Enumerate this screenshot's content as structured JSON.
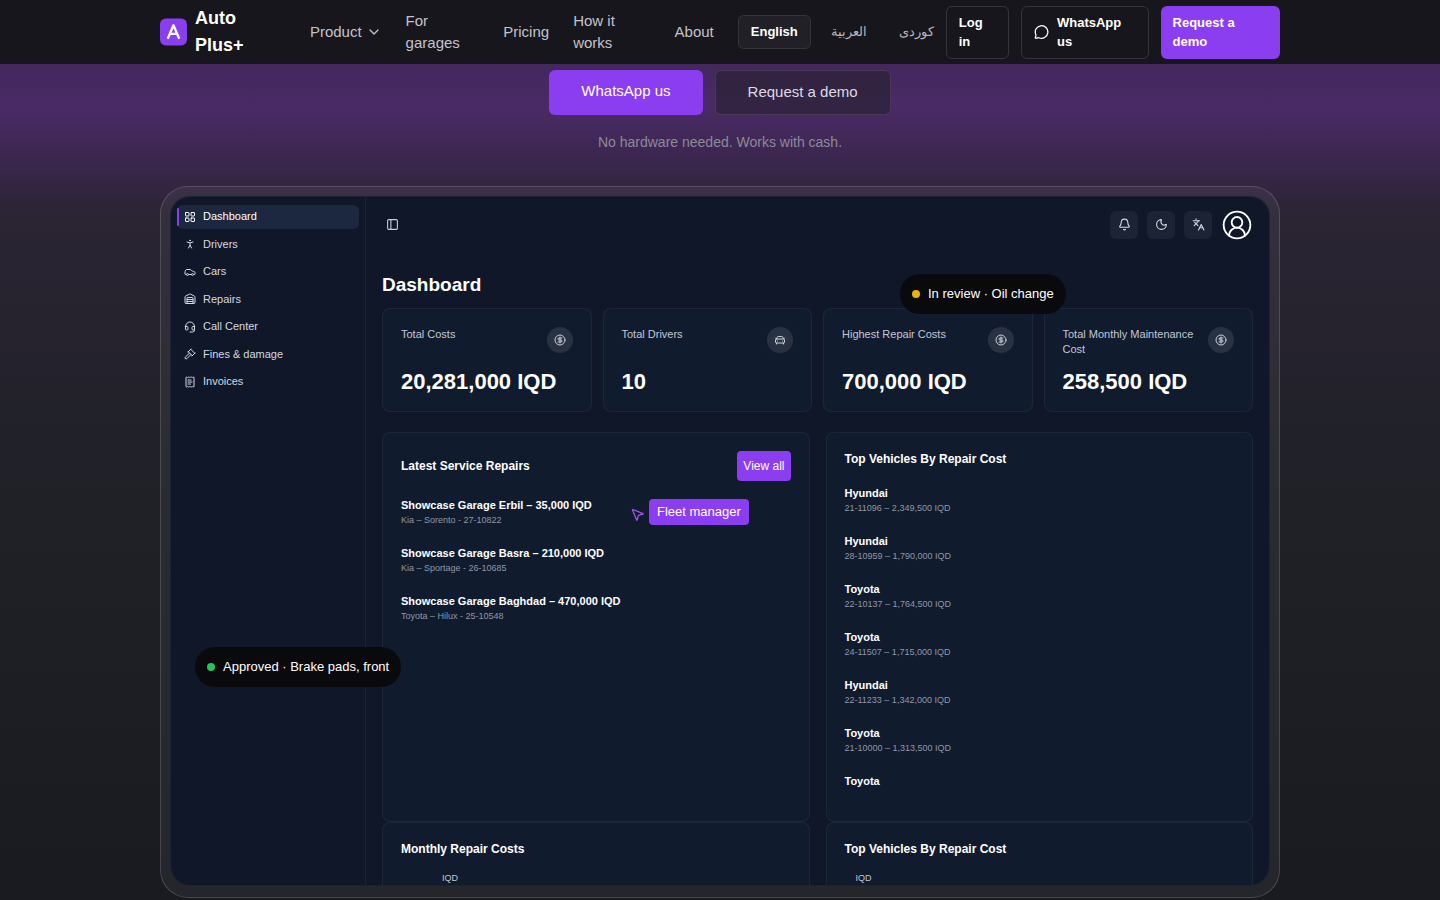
{
  "nav": {
    "brand": "Auto Plus+",
    "links": [
      {
        "label": "Product",
        "dropdown": true
      },
      {
        "label": "For garages",
        "dropdown": false
      },
      {
        "label": "Pricing",
        "dropdown": false
      },
      {
        "label": "How it works",
        "dropdown": false
      },
      {
        "label": "About",
        "dropdown": false
      }
    ],
    "languages": [
      {
        "label": "English",
        "selected": true
      },
      {
        "label": "العربية",
        "selected": false
      },
      {
        "label": "كوردی",
        "selected": false
      }
    ],
    "login": "Log in",
    "whatsapp": "WhatsApp us",
    "demo": "Request a demo"
  },
  "hero": {
    "buttons": [
      {
        "label": "WhatsApp us",
        "primary": true
      },
      {
        "label": "Request a demo",
        "primary": false
      }
    ],
    "note": "No hardware needed. Works with cash."
  },
  "dashboard": {
    "sidebar": [
      {
        "label": "Dashboard",
        "selected": true
      },
      {
        "label": "Drivers",
        "selected": false
      },
      {
        "label": "Cars",
        "selected": false
      },
      {
        "label": "Repairs",
        "selected": false
      },
      {
        "label": "Call Center",
        "selected": false
      },
      {
        "label": "Fines & damage",
        "selected": false
      },
      {
        "label": "Invoices",
        "selected": false
      }
    ],
    "title": "Dashboard",
    "stats": [
      {
        "label": "Total Costs",
        "value": "20,281,000 IQD"
      },
      {
        "label": "Total Drivers",
        "value": "10"
      },
      {
        "label": "Highest Repair Costs",
        "value": "700,000 IQD"
      },
      {
        "label": "Total Monthly Maintenance Cost",
        "value": "258,500 IQD"
      }
    ],
    "latest": {
      "title": "Latest Service Repairs",
      "action": "View all",
      "items": [
        {
          "title": "Showcase Garage Erbil – 35,000 IQD",
          "sub": "Kia – Sorento - 27-10822"
        },
        {
          "title": "Showcase Garage Basra – 210,000 IQD",
          "sub": "Kia – Sportage - 26-10685"
        },
        {
          "title": "Showcase Garage Baghdad – 470,000 IQD",
          "sub": "Toyota – Hilux - 25-10548"
        }
      ]
    },
    "top": {
      "title": "Top Vehicles By Repair Cost",
      "items": [
        {
          "name": "Hyundai",
          "sub": "21-11096 – 2,349,500 IQD"
        },
        {
          "name": "Hyundai",
          "sub": "28-10959 – 1,790,000 IQD"
        },
        {
          "name": "Toyota",
          "sub": "22-10137 – 1,764,500 IQD"
        },
        {
          "name": "Toyota",
          "sub": "24-11507 – 1,715,000 IQD"
        },
        {
          "name": "Hyundai",
          "sub": "22-11233 – 1,342,000 IQD"
        },
        {
          "name": "Toyota",
          "sub": "21-10000 – 1,313,500 IQD"
        },
        {
          "name": "Toyota",
          "sub": ""
        }
      ]
    },
    "bottom": [
      {
        "title": "Monthly Repair Costs",
        "axis": "IQD"
      },
      {
        "title": "Top Vehicles By Repair Cost",
        "axis": "IQD"
      }
    ]
  },
  "badges": [
    {
      "label": "In review · Oil change",
      "color": "#eab308"
    },
    {
      "label": "Approved · Brake pads, front",
      "color": "#22c55e"
    }
  ],
  "cursor": {
    "label": "Fleet manager"
  }
}
